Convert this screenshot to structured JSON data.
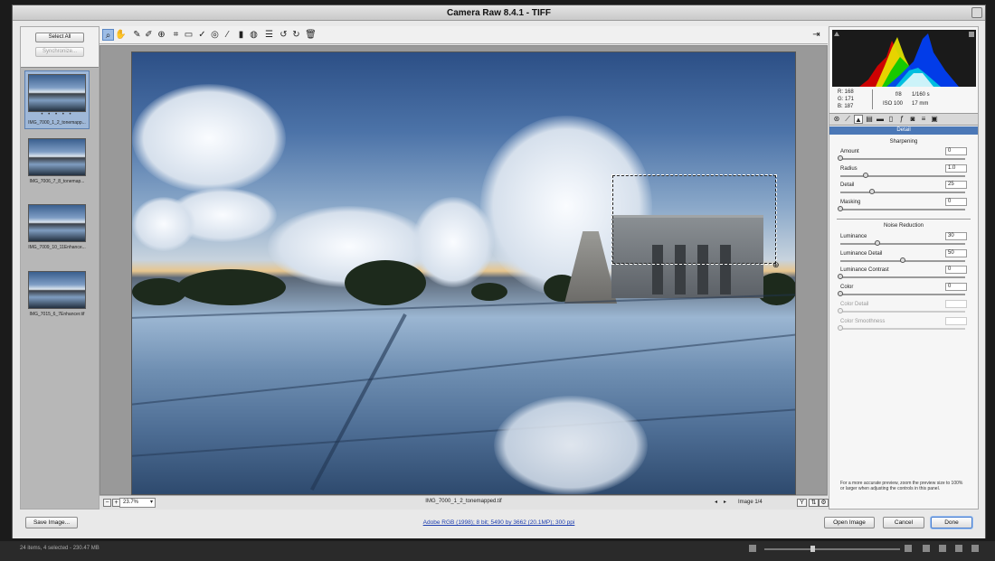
{
  "window": {
    "title": "Camera Raw 8.4.1  -  TIFF"
  },
  "left_panel": {
    "select_all": "Select All",
    "synchronize": "Synchronize...",
    "thumbnails": [
      {
        "caption": "IMG_7000_1_2_tonemapp...",
        "selected": true,
        "rating": "• • • • •"
      },
      {
        "caption": "IMG_7006_7_8_tonemap...",
        "selected": false
      },
      {
        "caption": "IMG_7009_10_11Enhance...",
        "selected": false
      },
      {
        "caption": "IMG_7015_6_7Enhancer.tif",
        "selected": false
      }
    ]
  },
  "toolbar": {
    "tools": [
      "zoom-icon",
      "hand-icon",
      "white-balance-icon",
      "color-sampler-icon",
      "targeted-adjustment-icon",
      "crop-icon",
      "straighten-icon",
      "spot-removal-icon",
      "red-eye-icon",
      "adjustment-brush-icon",
      "graduated-filter-icon",
      "radial-filter-icon",
      "preferences-icon",
      "rotate-ccw-icon",
      "rotate-cw-icon",
      "trash-icon"
    ],
    "active_tool": "zoom-icon"
  },
  "preview": {
    "filename": "IMG_7000_1_2_tonemapped.tif",
    "zoom": "23.7%",
    "image_counter": "Image 1/4"
  },
  "histogram": {
    "readout": {
      "r": "R:  168",
      "g": "G:  171",
      "b": "B:  187",
      "aperture": "f/8",
      "shutter": "1/160 s",
      "iso": "ISO 100",
      "focal": "17 mm"
    }
  },
  "detail_panel": {
    "title": "Detail",
    "sharpening_header": "Sharpening",
    "noise_header": "Noise Reduction",
    "sharpening": [
      {
        "label": "Amount",
        "value": "0",
        "level": 0.0
      },
      {
        "label": "Radius",
        "value": "1.0",
        "level": 0.2
      },
      {
        "label": "Detail",
        "value": "25",
        "level": 0.25
      },
      {
        "label": "Masking",
        "value": "0",
        "level": 0.0
      }
    ],
    "noise": [
      {
        "label": "Luminance",
        "value": "30",
        "level": 0.3,
        "enabled": true
      },
      {
        "label": "Luminance Detail",
        "value": "50",
        "level": 0.5,
        "enabled": true
      },
      {
        "label": "Luminance Contrast",
        "value": "0",
        "level": 0.0,
        "enabled": true
      },
      {
        "label": "Color",
        "value": "0",
        "level": 0.0,
        "enabled": true
      },
      {
        "label": "Color Detail",
        "value": "",
        "level": 0.0,
        "enabled": false
      },
      {
        "label": "Color Smoothness",
        "value": "",
        "level": 0.0,
        "enabled": false
      }
    ],
    "note": "For a more accurate preview, zoom the preview size to 100% or larger when adjusting the controls in this panel."
  },
  "footer": {
    "save_image": "Save Image...",
    "workflow_link": "Adobe RGB (1998); 8 bit; 5490 by 3662 (20.1MP); 300 ppi",
    "open_image": "Open Image",
    "cancel": "Cancel",
    "done": "Done"
  },
  "status_bar": {
    "text": "24 items, 4 selected - 230.47 MB"
  },
  "colors": {
    "accent": "#4b78b7",
    "selected_tool": "#9ebde6"
  }
}
